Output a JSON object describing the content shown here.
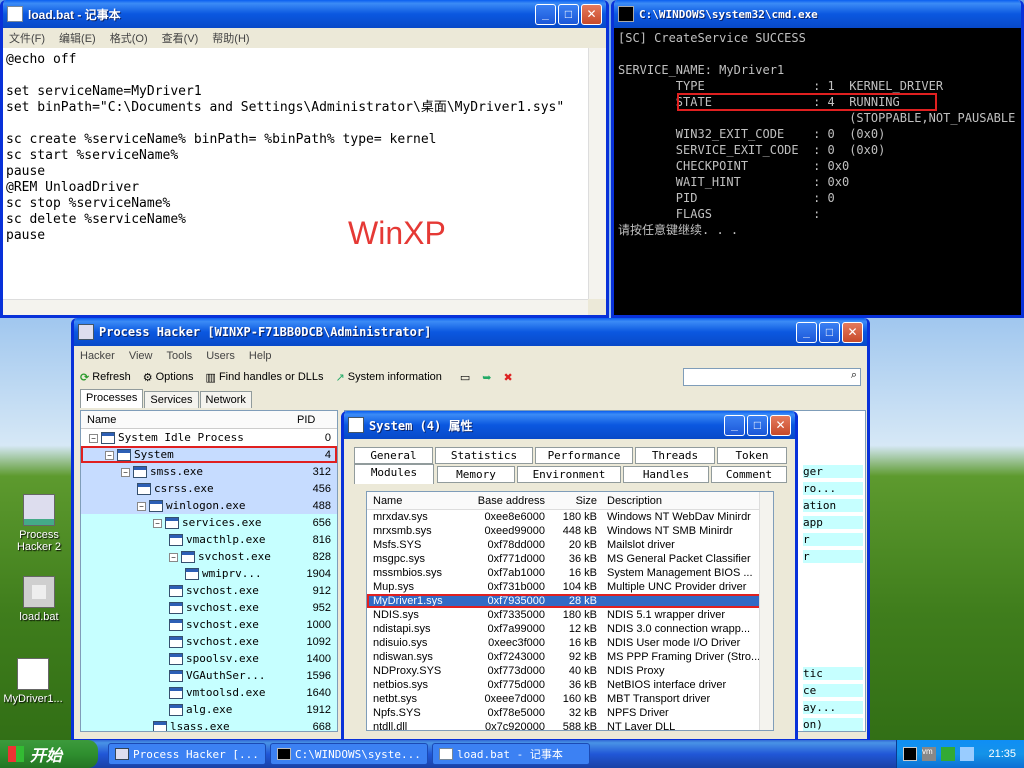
{
  "notepad": {
    "title": "load.bat - 记事本",
    "menu": [
      "文件(F)",
      "编辑(E)",
      "格式(O)",
      "查看(V)",
      "帮助(H)"
    ],
    "lines": [
      "@echo off",
      "",
      "set serviceName=MyDriver1",
      "set binPath=\"C:\\Documents and Settings\\Administrator\\桌面\\MyDriver1.sys\"",
      "",
      "sc create %serviceName% binPath= %binPath% type= kernel",
      "sc start %serviceName%",
      "pause",
      "@REM UnloadDriver",
      "sc stop %serviceName%",
      "sc delete %serviceName%",
      "pause"
    ]
  },
  "watermark": "WinXP",
  "cmd": {
    "title": "C:\\WINDOWS\\system32\\cmd.exe",
    "lines": [
      "[SC] CreateService SUCCESS",
      "",
      "SERVICE_NAME: MyDriver1",
      "        TYPE               : 1  KERNEL_DRIVER",
      "        STATE              : 4  RUNNING",
      "                                (STOPPABLE,NOT_PAUSABLE",
      "        WIN32_EXIT_CODE    : 0  (0x0)",
      "        SERVICE_EXIT_CODE  : 0  (0x0)",
      "        CHECKPOINT         : 0x0",
      "        WAIT_HINT          : 0x0",
      "        PID                : 0",
      "        FLAGS              :",
      "请按任意键继续. . ."
    ]
  },
  "process_hacker": {
    "title": "Process Hacker [WINXP-F71BB0DCB\\Administrator]",
    "menu": [
      "Hacker",
      "View",
      "Tools",
      "Users",
      "Help"
    ],
    "toolbar": {
      "refresh": "Refresh",
      "options": "Options",
      "find": "Find handles or DLLs",
      "sysinfo": "System information"
    },
    "tabs": [
      "Processes",
      "Services",
      "Network"
    ],
    "columns": {
      "name": "Name",
      "pid": "PID"
    },
    "processes": [
      {
        "name": "System Idle Process",
        "pid": "0"
      },
      {
        "name": "System",
        "pid": "4"
      },
      {
        "name": "smss.exe",
        "pid": "312"
      },
      {
        "name": "csrss.exe",
        "pid": "456"
      },
      {
        "name": "winlogon.exe",
        "pid": "488"
      },
      {
        "name": "services.exe",
        "pid": "656"
      },
      {
        "name": "vmacthlp.exe",
        "pid": "816"
      },
      {
        "name": "svchost.exe",
        "pid": "828"
      },
      {
        "name": "wmiprv...",
        "pid": "1904"
      },
      {
        "name": "svchost.exe",
        "pid": "912"
      },
      {
        "name": "svchost.exe",
        "pid": "952"
      },
      {
        "name": "svchost.exe",
        "pid": "1000"
      },
      {
        "name": "svchost.exe",
        "pid": "1092"
      },
      {
        "name": "spoolsv.exe",
        "pid": "1400"
      },
      {
        "name": "VGAuthSer...",
        "pid": "1596"
      },
      {
        "name": "vmtoolsd.exe",
        "pid": "1640"
      },
      {
        "name": "alg.exe",
        "pid": "1912"
      },
      {
        "name": "lsass.exe",
        "pid": "668"
      }
    ],
    "right_fragments": [
      "ger",
      "ro...",
      "ation",
      "app",
      "r",
      "r",
      "tic",
      "ce",
      "ay...",
      "on)"
    ]
  },
  "properties": {
    "title": "System (4) 属性",
    "tabs_top": [
      "General",
      "Statistics",
      "Performance",
      "Threads",
      "Token"
    ],
    "tabs_bottom": [
      "Modules",
      "Memory",
      "Environment",
      "Handles",
      "Comment"
    ],
    "columns": {
      "name": "Name",
      "base": "Base address",
      "size": "Size",
      "desc": "Description"
    },
    "modules": [
      {
        "name": "mrxdav.sys",
        "base": "0xee8e6000",
        "size": "180 kB",
        "desc": "Windows NT WebDav Minirdr"
      },
      {
        "name": "mrxsmb.sys",
        "base": "0xeed99000",
        "size": "448 kB",
        "desc": "Windows NT SMB Minirdr"
      },
      {
        "name": "Msfs.SYS",
        "base": "0xf78dd000",
        "size": "20 kB",
        "desc": "Mailslot driver"
      },
      {
        "name": "msgpc.sys",
        "base": "0xf771d000",
        "size": "36 kB",
        "desc": "MS General Packet Classifier"
      },
      {
        "name": "mssmbios.sys",
        "base": "0xf7ab1000",
        "size": "16 kB",
        "desc": "System Management BIOS ..."
      },
      {
        "name": "Mup.sys",
        "base": "0xf731b000",
        "size": "104 kB",
        "desc": "Multiple UNC Provider driver"
      },
      {
        "name": "MyDriver1.sys",
        "base": "0xf7935000",
        "size": "28 kB",
        "desc": ""
      },
      {
        "name": "NDIS.sys",
        "base": "0xf7335000",
        "size": "180 kB",
        "desc": "NDIS 5.1 wrapper driver"
      },
      {
        "name": "ndistapi.sys",
        "base": "0xf7a99000",
        "size": "12 kB",
        "desc": "NDIS 3.0 connection wrapp..."
      },
      {
        "name": "ndisuio.sys",
        "base": "0xeec3f000",
        "size": "16 kB",
        "desc": "NDIS User mode I/O Driver"
      },
      {
        "name": "ndiswan.sys",
        "base": "0xf7243000",
        "size": "92 kB",
        "desc": "MS PPP Framing Driver (Stro..."
      },
      {
        "name": "NDProxy.SYS",
        "base": "0xf773d000",
        "size": "40 kB",
        "desc": "NDIS Proxy"
      },
      {
        "name": "netbios.sys",
        "base": "0xf775d000",
        "size": "36 kB",
        "desc": "NetBIOS interface driver"
      },
      {
        "name": "netbt.sys",
        "base": "0xeee7d000",
        "size": "160 kB",
        "desc": "MBT Transport driver"
      },
      {
        "name": "Npfs.SYS",
        "base": "0xf78e5000",
        "size": "32 kB",
        "desc": "NPFS Driver"
      },
      {
        "name": "ntdll.dll",
        "base": "0x7c920000",
        "size": "588 kB",
        "desc": "NT Layer DLL"
      }
    ]
  },
  "desktop_icons": [
    "Process Hacker 2",
    "load.bat",
    "MyDriver1..."
  ],
  "taskbar": {
    "start": "开始",
    "buttons": [
      "Process Hacker [...",
      "C:\\WINDOWS\\syste...",
      "load.bat - 记事本"
    ],
    "time": "21:35"
  }
}
